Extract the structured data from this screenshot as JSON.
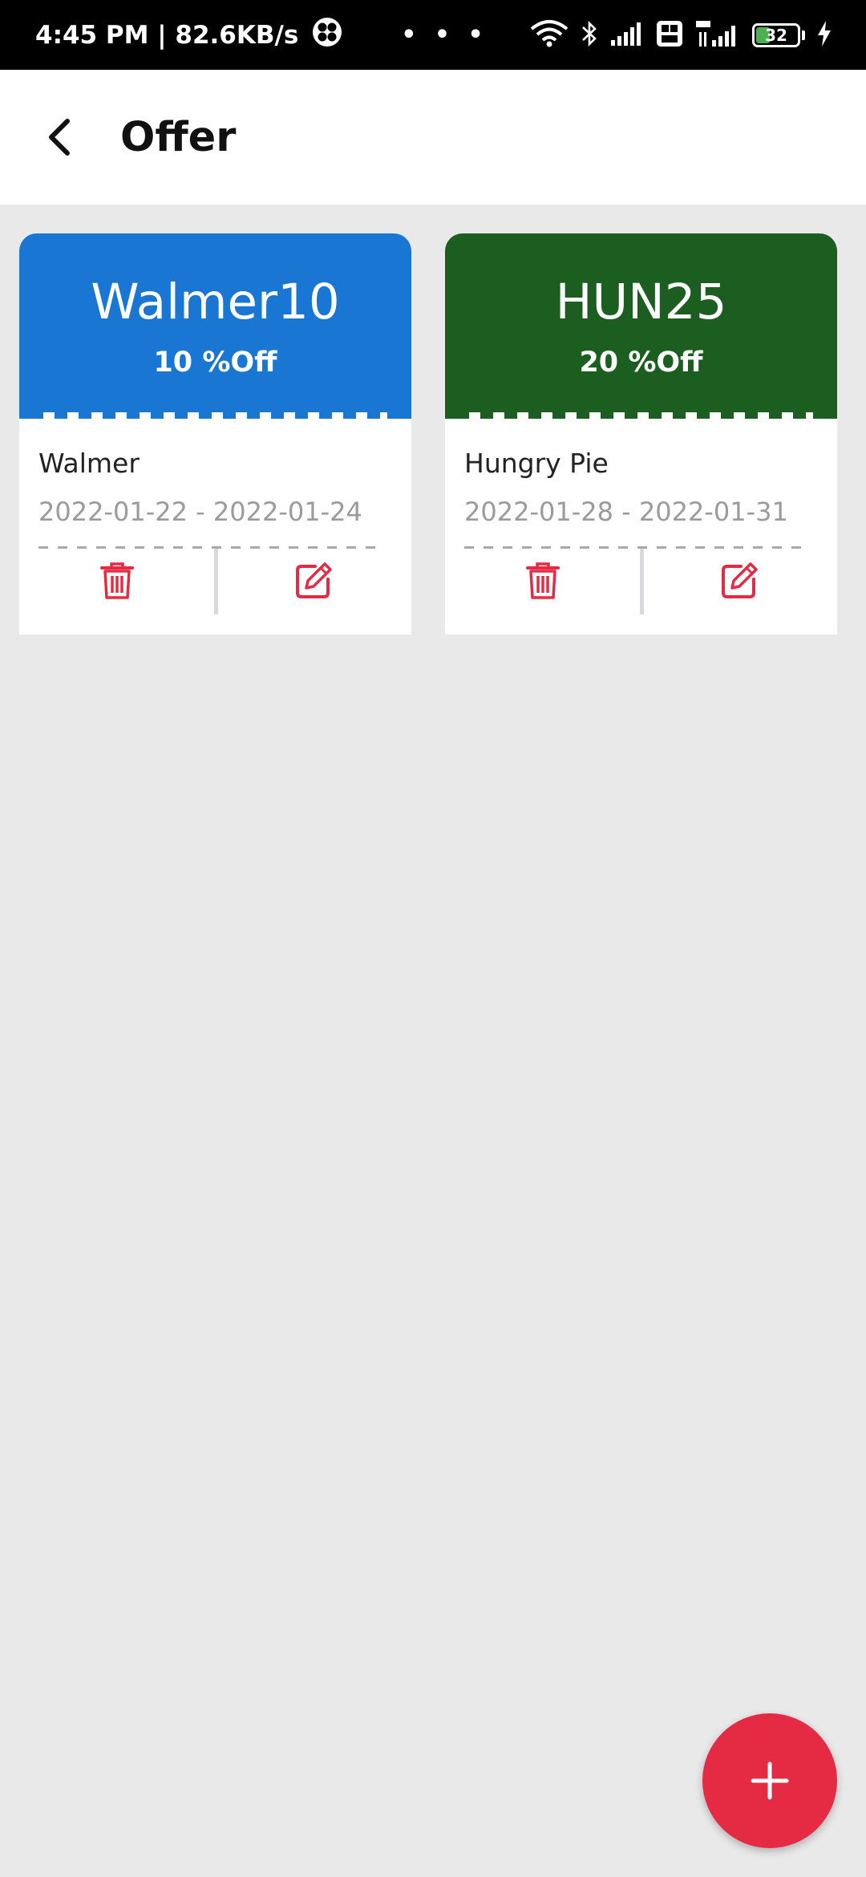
{
  "status_bar": {
    "time_speed": "4:45 PM | 82.6KB/s",
    "more": "• • •",
    "battery_level": "32"
  },
  "header": {
    "title": "Offer"
  },
  "offers": [
    {
      "code": "Walmer10",
      "discount": "10 %Off",
      "merchant": "Walmer",
      "dates": "2022-01-22 - 2022-01-24",
      "color": "#1976d2"
    },
    {
      "code": "HUN25",
      "discount": "20 %Off",
      "merchant": "Hungry Pie",
      "dates": "2022-01-28 - 2022-01-31",
      "color": "#1c5e20"
    }
  ],
  "icons": {
    "back": "arrow-back-icon",
    "delete": "trash-icon",
    "edit": "edit-icon",
    "add": "plus-icon"
  },
  "colors": {
    "accent": "#e52b44"
  }
}
